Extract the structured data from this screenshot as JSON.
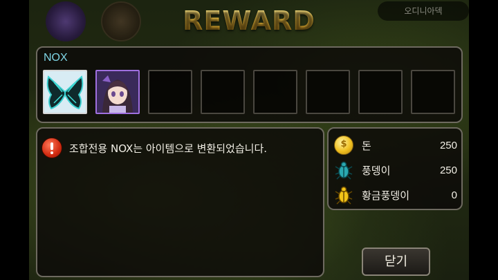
{
  "title": "REWARD",
  "top_right_chip": "오디니아덱",
  "items_panel": {
    "label": "NOX",
    "slots": [
      {
        "icon": "butterfly-wings-icon",
        "filled": true
      },
      {
        "icon": "nox-character-portrait",
        "filled": true
      },
      {
        "filled": false
      },
      {
        "filled": false
      },
      {
        "filled": false
      },
      {
        "filled": false
      },
      {
        "filled": false
      },
      {
        "filled": false
      }
    ]
  },
  "message": {
    "icon": "alert-exclamation-icon",
    "text": "조합전용 NOX는 아이템으로 변환되었습니다."
  },
  "resources": [
    {
      "icon": "gold-coin-icon",
      "label": "돈",
      "value": "250"
    },
    {
      "icon": "blue-beetle-icon",
      "label": "풍뎅이",
      "value": "250"
    },
    {
      "icon": "gold-beetle-icon",
      "label": "황금풍뎅이",
      "value": "0"
    }
  ],
  "close_button": "닫기",
  "colors": {
    "title_gold": "#e8b830",
    "nox_label": "#7fd6e6",
    "panel_border": "#6e6a60"
  }
}
